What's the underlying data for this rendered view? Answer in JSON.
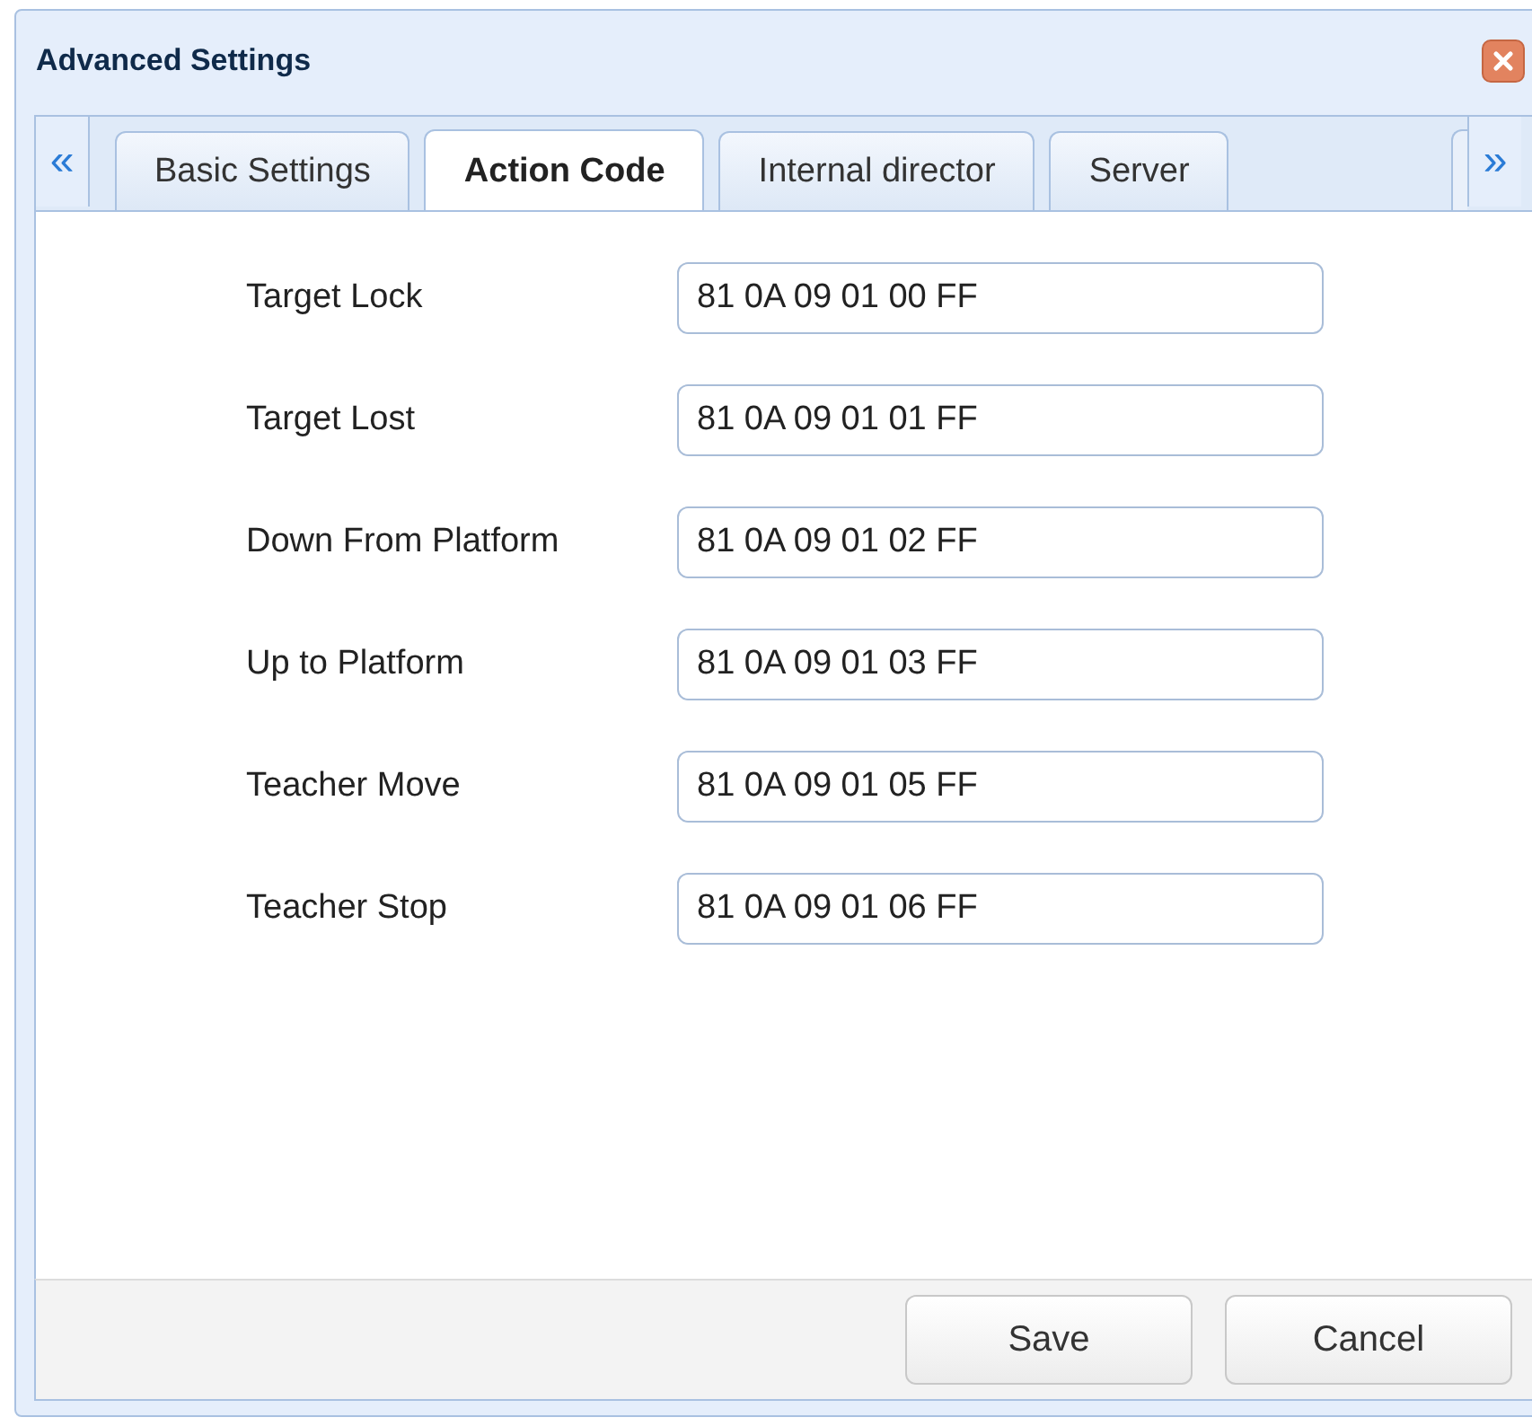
{
  "window": {
    "title": "Advanced Settings"
  },
  "tab_scroll": {
    "left": "«",
    "right": "»"
  },
  "tabs": [
    {
      "label": "Basic Settings",
      "selected": false
    },
    {
      "label": "Action Code",
      "selected": true
    },
    {
      "label": "Internal director",
      "selected": false
    },
    {
      "label": "Server",
      "selected": false
    }
  ],
  "fields": [
    {
      "label": "Target Lock",
      "value": "81 0A 09 01 00 FF"
    },
    {
      "label": "Target Lost",
      "value": "81 0A 09 01 01 FF"
    },
    {
      "label": "Down From Platform",
      "value": "81 0A 09 01 02 FF"
    },
    {
      "label": "Up to Platform",
      "value": "81 0A 09 01 03 FF"
    },
    {
      "label": "Teacher Move",
      "value": "81 0A 09 01 05 FF"
    },
    {
      "label": "Teacher Stop",
      "value": "81 0A 09 01 06 FF"
    }
  ],
  "buttons": [
    "Save",
    "Cancel"
  ]
}
